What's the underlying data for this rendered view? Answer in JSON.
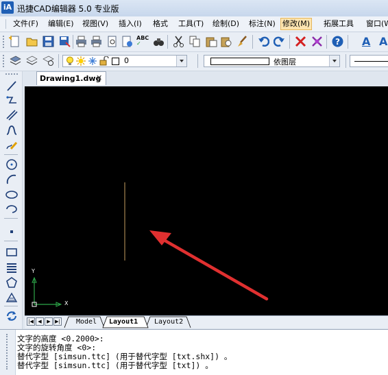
{
  "window": {
    "title": "迅捷CAD编辑器 5.0 专业版",
    "icon_text": "iA"
  },
  "menu": [
    {
      "label": "文件(F)"
    },
    {
      "label": "编辑(E)"
    },
    {
      "label": "视图(V)"
    },
    {
      "label": "插入(I)"
    },
    {
      "label": "格式"
    },
    {
      "label": "工具(T)"
    },
    {
      "label": "绘制(D)"
    },
    {
      "label": "标注(N)"
    },
    {
      "label": "修改(M)",
      "active": true
    },
    {
      "label": "拓展工具"
    },
    {
      "label": "窗口(W)"
    }
  ],
  "layer_toolbar": {
    "layer_value": "0",
    "linetype_value": "依图层"
  },
  "document": {
    "tab_label": "Drawing1.dwg",
    "close_glyph": "✕"
  },
  "ucs": {
    "x_label": "X",
    "y_label": "Y"
  },
  "layout_tabs": [
    {
      "label": "Model"
    },
    {
      "label": "Layout1",
      "active": true
    },
    {
      "label": "Layout2"
    }
  ],
  "command_history": [
    "文字的高度 <0.2000>:",
    "文字的旋转角度 <0>:",
    "替代字型 [simsun.ttc] (用于替代字型 [txt.shx]) 。",
    "替代字型 [simsun.ttc] (用于替代字型 [txt]) 。"
  ],
  "colors": {
    "canvas": "#000000",
    "drawn_line": "#c8a060",
    "annotation_arrow": "#e03030",
    "ucs_axis": "#2ea84a",
    "active_menu": "#fce4b0"
  }
}
